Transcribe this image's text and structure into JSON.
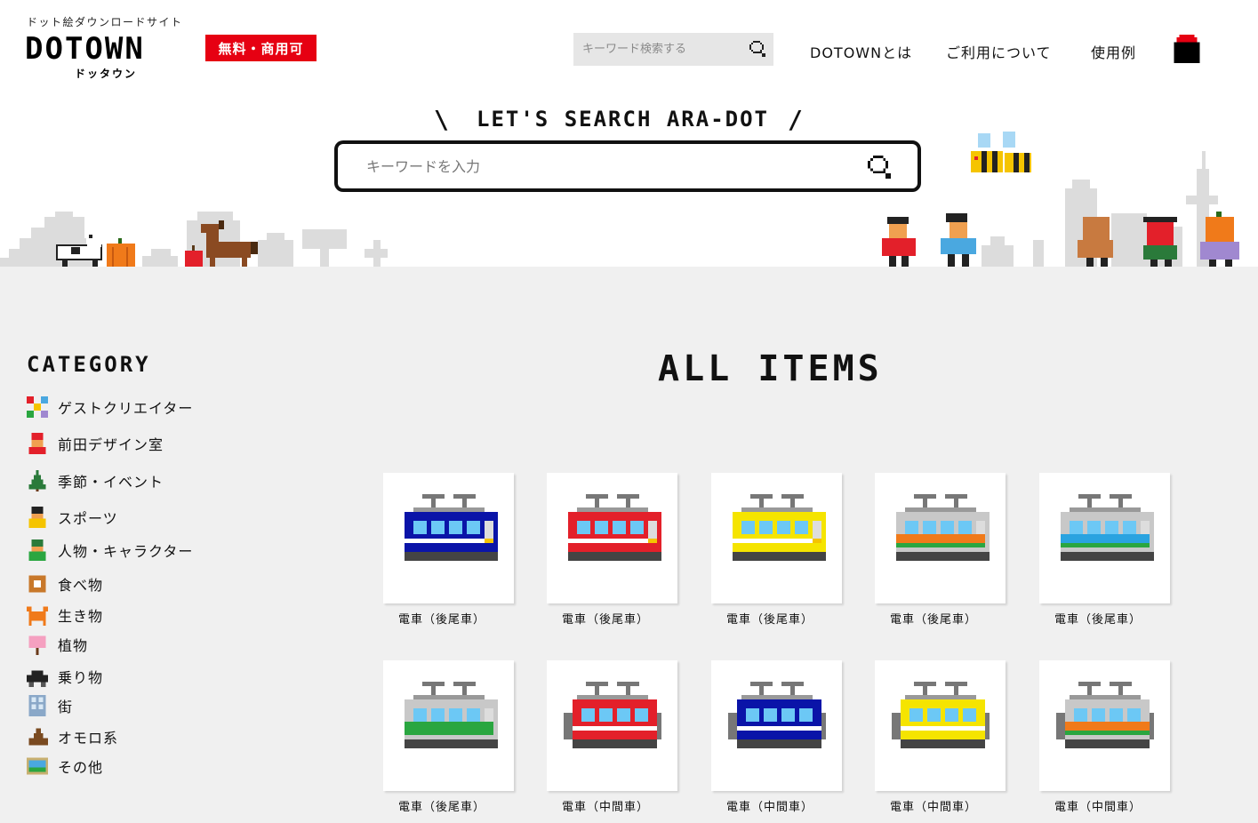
{
  "header": {
    "tagline": "ドット絵ダウンロードサイト",
    "logo": "DOTOWN",
    "logo_kana": "ドッタウン",
    "free_badge": "無料・商用可",
    "search_placeholder": "キーワード検索する",
    "nav": {
      "about": "DOTOWNとは",
      "usage": "ご利用について",
      "examples": "使用例"
    }
  },
  "hero": {
    "slogan": "LET'S SEARCH ARA-DOT",
    "search_placeholder": "キーワードを入力"
  },
  "sidebar": {
    "title": "CATEGORY",
    "items": [
      {
        "label": "ゲストクリエイター",
        "icon": "guest-creator-icon"
      },
      {
        "label": "前田デザイン室",
        "icon": "maeda-design-icon"
      },
      {
        "label": "季節・イベント",
        "icon": "tree-icon"
      },
      {
        "label": "スポーツ",
        "icon": "sports-icon"
      },
      {
        "label": "人物・キャラクター",
        "icon": "person-icon"
      },
      {
        "label": "食べ物",
        "icon": "food-icon"
      },
      {
        "label": "生き物",
        "icon": "crab-icon"
      },
      {
        "label": "植物",
        "icon": "plant-icon"
      },
      {
        "label": "乗り物",
        "icon": "car-icon"
      },
      {
        "label": "街",
        "icon": "building-icon"
      },
      {
        "label": "オモロ系",
        "icon": "poop-icon"
      },
      {
        "label": "その他",
        "icon": "picture-icon"
      }
    ]
  },
  "main": {
    "title": "ALL ITEMS",
    "items": [
      {
        "label": "電車（後尾車）",
        "body": "#0a14a8",
        "stripe": "#ffffff",
        "type": "rear"
      },
      {
        "label": "電車（後尾車）",
        "body": "#e3202a",
        "stripe": "#ffffff",
        "type": "rear"
      },
      {
        "label": "電車（後尾車）",
        "body": "#f5e400",
        "stripe": "#ffffff",
        "type": "rear"
      },
      {
        "label": "電車（後尾車）",
        "body": "#c8c8c8",
        "stripe": "#f07a1a",
        "type": "rear"
      },
      {
        "label": "電車（後尾車）",
        "body": "#c8c8c8",
        "stripe": "#2aa3e0",
        "type": "rear"
      },
      {
        "label": "電車（後尾車）",
        "body": "#c8c8c8",
        "stripe": "#2aa640",
        "type": "rear"
      },
      {
        "label": "電車（中間車）",
        "body": "#e3202a",
        "stripe": "#ffffff",
        "type": "middle"
      },
      {
        "label": "電車（中間車）",
        "body": "#0a14a8",
        "stripe": "#ffffff",
        "type": "middle"
      },
      {
        "label": "電車（中間車）",
        "body": "#f5e400",
        "stripe": "#ffffff",
        "type": "middle"
      },
      {
        "label": "電車（中間車）",
        "body": "#c8c8c8",
        "stripe": "#f07a1a",
        "type": "middle"
      }
    ]
  },
  "colors": {
    "accent_red": "#e60012",
    "main_bg": "#f0f0f0"
  }
}
